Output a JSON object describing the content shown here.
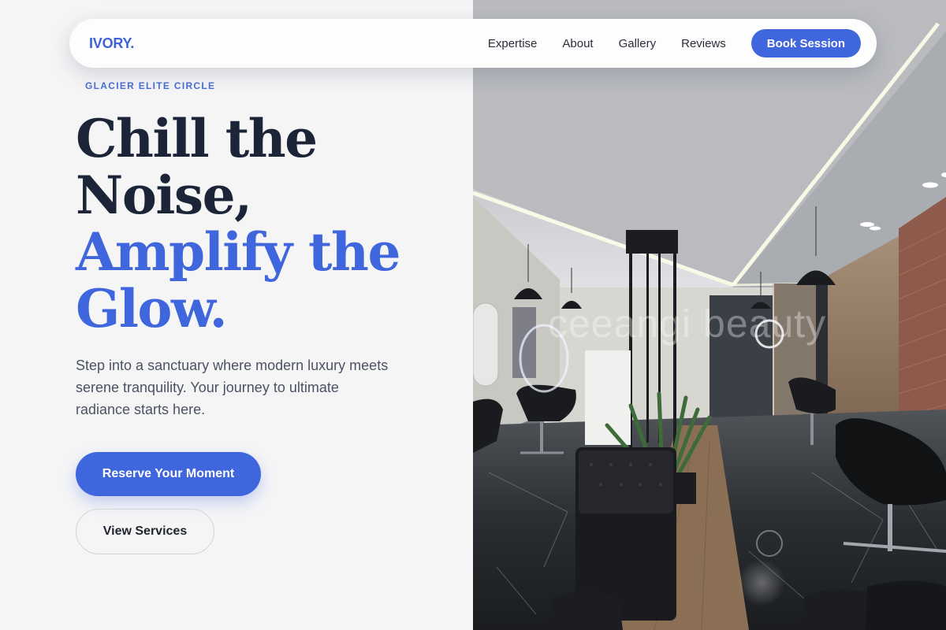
{
  "brand": {
    "name": "IVORY."
  },
  "nav": {
    "links": [
      "Expertise",
      "About",
      "Gallery",
      "Reviews"
    ],
    "cta": "Book Session"
  },
  "hero": {
    "eyebrow": "GLACIER ELITE CIRCLE",
    "headline_dark": [
      "Chill the",
      "Noise,"
    ],
    "headline_accent": [
      "Amplify the",
      "Glow."
    ],
    "lede": "Step into a sanctuary where modern luxury meets serene tranquility. Your journey to ultimate radiance starts here.",
    "primary_button": "Reserve Your Moment",
    "secondary_button": "View Services"
  },
  "photo": {
    "watermark": "ceeangi beauty"
  },
  "colors": {
    "accent": "#3f66dd",
    "heading": "#1c2438",
    "body_text": "#4b5263",
    "background": "#f5f5f6"
  }
}
